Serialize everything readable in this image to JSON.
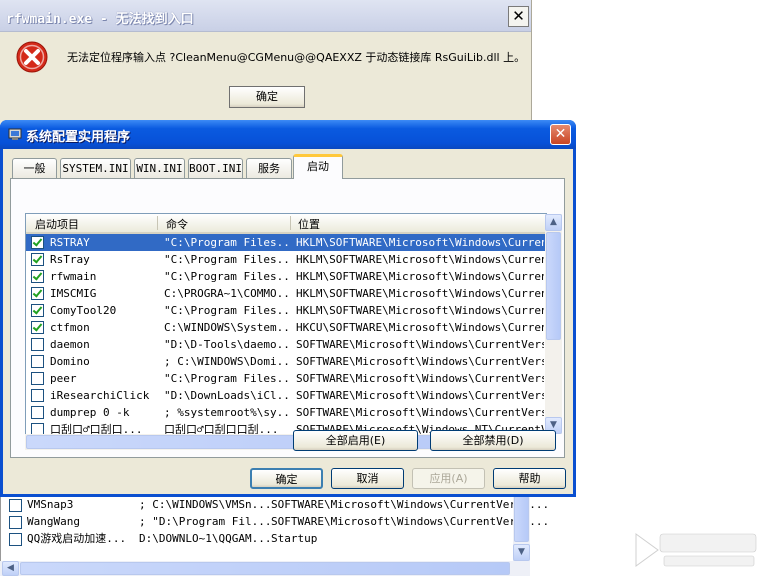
{
  "error_dialog": {
    "title": "rfwmain.exe - 无法找到入口",
    "close_glyph": "✕",
    "message": "无法定位程序输入点 ?CleanMenu@CGMenu@@QAEXXZ 于动态链接库 RsGuiLib.dll 上。",
    "ok_label": "确定"
  },
  "window": {
    "title": "系统配置实用程序",
    "close_glyph": "✕",
    "tabs": [
      {
        "label": "一般"
      },
      {
        "label": "SYSTEM.INI"
      },
      {
        "label": "WIN.INI"
      },
      {
        "label": "BOOT.INI"
      },
      {
        "label": "服务"
      },
      {
        "label": "启动"
      }
    ],
    "active_tab": "启动",
    "columns": [
      "启动项目",
      "命令",
      "位置"
    ],
    "rows": [
      {
        "checked": true,
        "item": "RSTRAY",
        "command": "\"C:\\Program Files...",
        "location": "HKLM\\SOFTWARE\\Microsoft\\Windows\\Current..."
      },
      {
        "checked": true,
        "item": "RsTray",
        "command": "\"C:\\Program Files...",
        "location": "HKLM\\SOFTWARE\\Microsoft\\Windows\\Current..."
      },
      {
        "checked": true,
        "item": "rfwmain",
        "command": "\"C:\\Program Files...",
        "location": "HKLM\\SOFTWARE\\Microsoft\\Windows\\Current..."
      },
      {
        "checked": true,
        "item": "IMSCMIG",
        "command": "C:\\PROGRA~1\\COMMO...",
        "location": "HKLM\\SOFTWARE\\Microsoft\\Windows\\Current..."
      },
      {
        "checked": true,
        "item": "ComyTool20",
        "command": "\"C:\\Program Files...",
        "location": "HKLM\\SOFTWARE\\Microsoft\\Windows\\Current..."
      },
      {
        "checked": true,
        "item": "ctfmon",
        "command": "C:\\WINDOWS\\System...",
        "location": "HKCU\\SOFTWARE\\Microsoft\\Windows\\Current..."
      },
      {
        "checked": false,
        "item": "daemon",
        "command": "\"D:\\D-Tools\\daemo...",
        "location": "SOFTWARE\\Microsoft\\Windows\\CurrentVersi..."
      },
      {
        "checked": false,
        "item": "Domino",
        "command": "; C:\\WINDOWS\\Domi...",
        "location": "SOFTWARE\\Microsoft\\Windows\\CurrentVersi..."
      },
      {
        "checked": false,
        "item": "peer",
        "command": "\"C:\\Program Files...",
        "location": "SOFTWARE\\Microsoft\\Windows\\CurrentVersi..."
      },
      {
        "checked": false,
        "item": "iResearchiClick",
        "command": "\"D:\\DownLoads\\iCl...",
        "location": "SOFTWARE\\Microsoft\\Windows\\CurrentVersi..."
      },
      {
        "checked": false,
        "item": "dumprep 0 -k",
        "command": "; %systemroot%\\sy...",
        "location": "SOFTWARE\\Microsoft\\Windows\\CurrentVersi..."
      },
      {
        "checked": false,
        "item": "口刮口♂口刮口...",
        "command": "口刮口♂口刮口口刮...",
        "location": "SOFTWARE\\Microsoft\\Windows NT\\CurrentVe..."
      }
    ],
    "enable_all_label": "全部启用(E)",
    "disable_all_label": "全部禁用(D)",
    "ok_label": "确定",
    "cancel_label": "取消",
    "apply_label": "应用(A)",
    "help_label": "帮助",
    "scroll_up_glyph": "▲",
    "scroll_down_glyph": "▼",
    "scroll_left_glyph": "◀",
    "scroll_right_glyph": "▶"
  },
  "background_list": {
    "rows": [
      {
        "checked": false,
        "item": "VMSnap3",
        "command": "; C:\\WINDOWS\\VMSn...",
        "location": "SOFTWARE\\Microsoft\\Windows\\CurrentVersi..."
      },
      {
        "checked": false,
        "item": "WangWang",
        "command": "; \"D:\\Program Fil...",
        "location": "SOFTWARE\\Microsoft\\Windows\\CurrentVersi..."
      },
      {
        "checked": false,
        "item": "QQ游戏启动加速...",
        "command": "D:\\DOWNLO~1\\QQGAM...",
        "location": "Startup"
      }
    ]
  },
  "colors": {
    "titlebar_blue": "#0a5ae0",
    "selection_blue": "#316ac5",
    "error_red": "#d42a1a",
    "dialog_face": "#ece9d8"
  },
  "icons": {
    "error": "error-icon",
    "app": "msconfig-app-icon"
  }
}
